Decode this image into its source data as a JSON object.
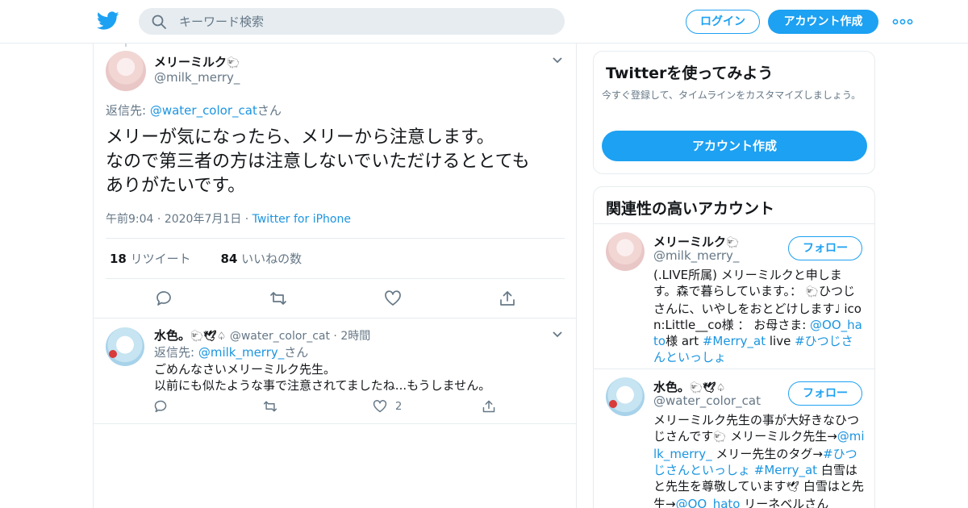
{
  "header": {
    "search_placeholder": "キーワード検索",
    "login_label": "ログイン",
    "signup_label": "アカウント作成"
  },
  "tweet": {
    "name": "メリーミルク",
    "name_emoji": "🐑",
    "handle": "@milk_merry_",
    "reply_prefix": "返信先: ",
    "reply_handle": "@water_color_cat",
    "reply_suffix": "さん",
    "text": "メリーが気になったら、メリーから注意します。\nなので第三者の方は注意しないでいただけるととても\nありがたいです。",
    "time": "午前9:04",
    "date": "2020年7月1日",
    "source": "Twitter for iPhone",
    "retweets_count": "18",
    "retweets_label": "リツイート",
    "likes_count": "84",
    "likes_label": "いいねの数"
  },
  "reply": {
    "name": "水色。",
    "name_emoji": "🐑🕊♤",
    "handle": "@water_color_cat",
    "time": "2時間",
    "reply_prefix": "返信先: ",
    "reply_handle": "@milk_merry_",
    "reply_suffix": "さん",
    "text": "ごめんなさいメリーミルク先生。\n以前にも似たような事で注意されてましたね...もうしません。",
    "like_count": "2"
  },
  "sidebar": {
    "signup_card": {
      "title": "Twitterを使ってみよう",
      "desc": "今すぐ登録して、タイムラインをカスタマイズしましょう。",
      "button": "アカウント作成"
    },
    "related": {
      "title": "関連性の高いアカウント",
      "follow_label": "フォロー",
      "users": [
        {
          "name": "メリーミルク",
          "name_emoji": "🐑",
          "handle": "@milk_merry_",
          "bio_1": "(.LIVE所属) メリーミルクと申します。森で暮らしています。： ",
          "bio_emoji_1": "🐑",
          "bio_2": "ひつじさんに、いやしをおとどけします♩ icon:Little__co様 ： お母さま: ",
          "bio_link_1": "@OO_hato",
          "bio_3": "様 art ",
          "bio_link_2": "#Merry_at",
          "bio_4": " live ",
          "bio_link_3": "#ひつじさんといっしょ"
        },
        {
          "name": "水色。",
          "name_emoji": "🐑🕊♤",
          "handle": "@water_color_cat",
          "bio_1": "メリーミルク先生の事が大好きなひつじさんです",
          "bio_emoji_1": "🐑",
          "bio_2": " メリーミルク先生→",
          "bio_link_1": "@milk_merry_",
          "bio_3": " メリー先生のタグ→",
          "bio_link_2": "#ひつじさんといっしょ",
          "bio_4": " ",
          "bio_link_3": "#Merry_at",
          "bio_5": " 白雪はと先生を尊敬しています",
          "bio_emoji_2": "🕊",
          "bio_6": " 白雪はと先生→",
          "bio_link_4": "@OO_hato",
          "bio_7": " リーネベルさん"
        }
      ]
    }
  },
  "colors": {
    "accent": "#1da1f2",
    "link": "#1b95e0",
    "muted": "#657786",
    "border": "#e6ecf0"
  }
}
